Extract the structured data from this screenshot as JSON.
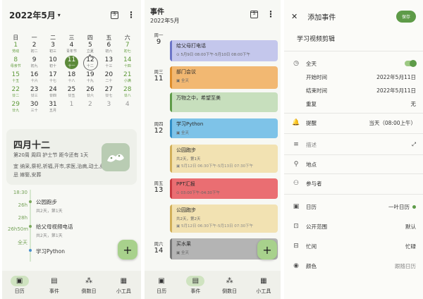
{
  "calendar": {
    "title": "2022年5月",
    "cal_icon_day": "5",
    "weekdays": [
      "日",
      "一",
      "二",
      "三",
      "四",
      "五",
      "六"
    ],
    "days": [
      {
        "n": "1",
        "s": "劳动",
        "k": "green"
      },
      {
        "n": "2",
        "s": "初二",
        "k": ""
      },
      {
        "n": "3",
        "s": "初三",
        "k": ""
      },
      {
        "n": "4",
        "s": "青年节",
        "k": ""
      },
      {
        "n": "5",
        "s": "立夏",
        "k": "dot"
      },
      {
        "n": "6",
        "s": "初六",
        "k": ""
      },
      {
        "n": "7",
        "s": "初七",
        "k": "green"
      },
      {
        "n": "8",
        "s": "母亲节",
        "k": "green"
      },
      {
        "n": "9",
        "s": "初九",
        "k": ""
      },
      {
        "n": "10",
        "s": "初十",
        "k": ""
      },
      {
        "n": "11",
        "s": "十一",
        "k": "today"
      },
      {
        "n": "12",
        "s": "十二",
        "k": "sel"
      },
      {
        "n": "13",
        "s": "十三",
        "k": ""
      },
      {
        "n": "14",
        "s": "十四",
        "k": "green"
      },
      {
        "n": "15",
        "s": "十五",
        "k": "green"
      },
      {
        "n": "16",
        "s": "十六",
        "k": ""
      },
      {
        "n": "17",
        "s": "十七",
        "k": ""
      },
      {
        "n": "18",
        "s": "十八",
        "k": ""
      },
      {
        "n": "19",
        "s": "十九",
        "k": ""
      },
      {
        "n": "20",
        "s": "二十",
        "k": ""
      },
      {
        "n": "21",
        "s": "小满",
        "k": "green"
      },
      {
        "n": "22",
        "s": "廿二",
        "k": "green"
      },
      {
        "n": "23",
        "s": "廿三",
        "k": ""
      },
      {
        "n": "24",
        "s": "廿四",
        "k": ""
      },
      {
        "n": "25",
        "s": "廿五",
        "k": ""
      },
      {
        "n": "26",
        "s": "廿六",
        "k": ""
      },
      {
        "n": "27",
        "s": "廿七",
        "k": ""
      },
      {
        "n": "28",
        "s": "廿八",
        "k": "green"
      },
      {
        "n": "29",
        "s": "廿九",
        "k": "green"
      },
      {
        "n": "30",
        "s": "三十",
        "k": ""
      },
      {
        "n": "31",
        "s": "五月",
        "k": ""
      },
      {
        "n": "1",
        "s": "",
        "k": "dim"
      },
      {
        "n": "2",
        "s": "",
        "k": "dim"
      },
      {
        "n": "3",
        "s": "",
        "k": "dim"
      },
      {
        "n": "4",
        "s": "",
        "k": "dim"
      }
    ],
    "day_card": {
      "title": "四月十二",
      "sub": "第20周  周四  护士节  距今还有  1天",
      "yi": "宜  纳采,祭祀,祈福,开市,求医,治病,动土,纳畜",
      "ji": "忌  嫁娶,安葬"
    },
    "timeline": {
      "times": [
        "18:30",
        "26h",
        "28h",
        "26h50m",
        "全天"
      ],
      "events": [
        {
          "title": "公园跑步",
          "sub": "共2天，第1天"
        },
        {
          "title": "给父母视频电话",
          "sub": "共2天，第1天"
        },
        {
          "title": "学习Python",
          "sub": ""
        }
      ]
    },
    "fab": "+"
  },
  "nav": {
    "items": [
      {
        "label": "日历",
        "icon": "▣"
      },
      {
        "label": "事件",
        "icon": "▤"
      },
      {
        "label": "倒数日",
        "icon": "⁂"
      },
      {
        "label": "小工具",
        "icon": "▦"
      }
    ]
  },
  "events": {
    "title": "事件",
    "subtitle": "2022年5月",
    "cal_icon_day": "5",
    "fab": "+",
    "days": [
      {
        "w": "周一",
        "d": "9"
      },
      {
        "w": "周三",
        "d": "11"
      },
      {
        "w": "周四",
        "d": "12"
      },
      {
        "w": "周五",
        "d": "13"
      },
      {
        "w": "周六",
        "d": "14"
      }
    ],
    "items": [
      {
        "title": "给父母打电话",
        "l2": "⊙ 5月9日 08:00下午-5月10日 08:00下午"
      },
      {
        "title": "部门会议",
        "l2": "▣ 全天"
      },
      {
        "title": "万物之中，希望至美",
        "l2": ""
      },
      {
        "title": "学习Python",
        "l2": "▣ 全天"
      },
      {
        "title": "公园跑步",
        "l2": "共2天，第1天",
        "l3": "▣ 5月12日 06:30下午-5月13日 07:30下午"
      },
      {
        "title": "PPT汇报",
        "l2": "⊙ 03:00下午-04:30下午"
      },
      {
        "title": "公园跑步",
        "l2": "共2天，第2天",
        "l3": "▣ 5月12日 06:30下午-5月13日 07:30下午"
      },
      {
        "title": "买水果",
        "l2": "▣ 全天"
      }
    ]
  },
  "add_event": {
    "close_icon": "✕",
    "title": "添加事件",
    "save_label": "保存",
    "event_title": "学习视频剪辑",
    "all_day": "全天",
    "start_label": "开始时间",
    "start_value": "2022年5月11日",
    "end_label": "结束时间",
    "end_value": "2022年5月11日",
    "repeat_label": "重复",
    "repeat_value": "无",
    "reminder_label": "提醒",
    "reminder_value": "当天（08:00上午）",
    "desc_label": "描述",
    "location_label": "地点",
    "attendees_label": "参与者",
    "calendar_label": "日历",
    "calendar_value": "一叶日历",
    "visibility_label": "公开范围",
    "visibility_value": "默认",
    "busy_label": "忙闲",
    "busy_value": "忙碌",
    "color_label": "颜色",
    "color_value": "跟随日历"
  },
  "icons": {
    "caret": "▾",
    "more": "⋮",
    "expand": "⤢",
    "clock": "◷",
    "bell": "🔔",
    "desc": "≡",
    "pin": "⚲",
    "people": "⚇",
    "calendar": "▣",
    "lock": "⊡",
    "bag": "⊟",
    "palette": "◉"
  },
  "colors": {
    "accent": "#5e9b48",
    "today": "#5c8a3a",
    "fab": "#a8d18c"
  }
}
